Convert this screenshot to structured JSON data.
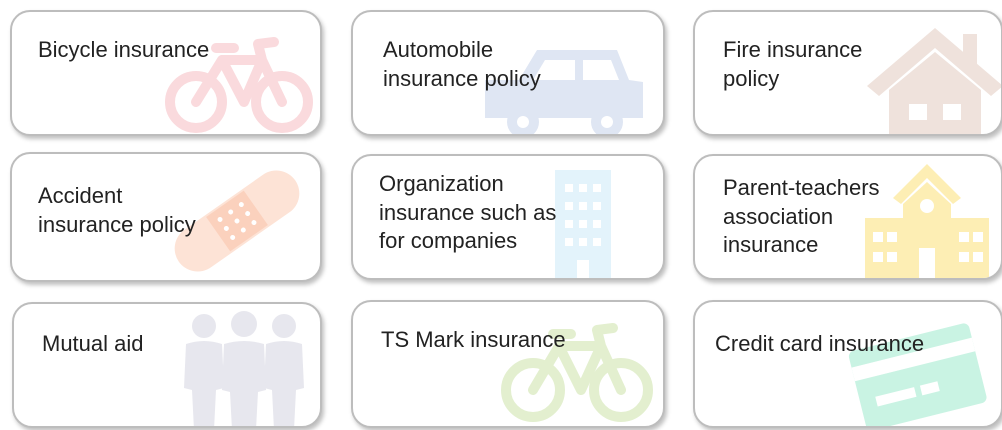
{
  "cards": [
    {
      "label": "Bicycle insurance",
      "icon": "bicycle-icon",
      "icon_color": "#fadadd"
    },
    {
      "label": "Automobile\ninsurance policy",
      "icon": "car-icon",
      "icon_color": "#dfe6f3"
    },
    {
      "label": "Fire insurance\npolicy",
      "icon": "house-icon",
      "icon_color": "#efe2dc"
    },
    {
      "label": "Accident\ninsurance policy",
      "icon": "bandage-icon",
      "icon_color": "#fde3d6"
    },
    {
      "label": "Organization\ninsurance such as\nfor companies",
      "icon": "building-icon",
      "icon_color": "#e3f3fb"
    },
    {
      "label": "Parent-teachers\nassociation\ninsurance",
      "icon": "school-icon",
      "icon_color": "#fdeeb4"
    },
    {
      "label": "Mutual aid",
      "icon": "people-icon",
      "icon_color": "#e7e7ee"
    },
    {
      "label": "TS Mark insurance",
      "icon": "bicycle-icon",
      "icon_color": "#e3efcf"
    },
    {
      "label": "Credit card insurance",
      "icon": "credit-card-icon",
      "icon_color": "#c9f3e3"
    }
  ]
}
